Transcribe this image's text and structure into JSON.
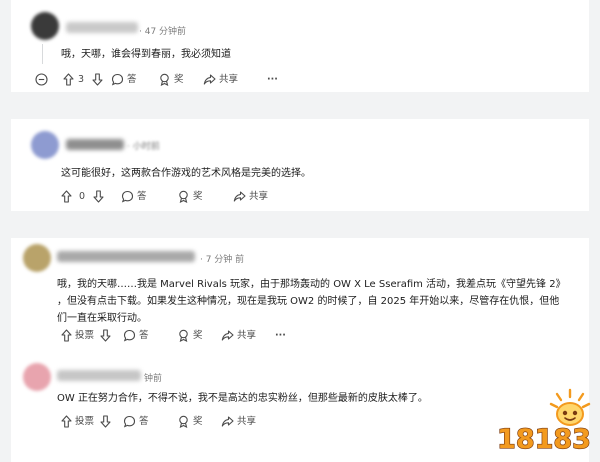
{
  "comments": [
    {
      "meta": "· 47 分钟前",
      "text": [
        "哦，天哪，谁会得到春丽，我必须知道"
      ],
      "votes": "3",
      "reply_label": "答",
      "award_label": "奖",
      "share_label": "共享",
      "more_label": "···"
    },
    {
      "meta": "· 小时前",
      "text": [
        "这可能很好，这两款合作游戏的艺术风格是完美的选择。"
      ],
      "votes": "0",
      "reply_label": "答",
      "award_label": "奖",
      "share_label": "共享",
      "more_label": "···"
    },
    {
      "meta": "· 7 分钟 前",
      "text": [
        "哦，我的天哪……我是 Marvel Rivals 玩家，由于那场轰动的 OW X Le Sserafim 活动，我差点玩《守望先锋 2》",
        "，但没有点击下载。如果发生这种情况，现在是我玩 OW2 的时候了，自 2025 年开始以来，尽管存在仇恨，但他",
        "们一直在采取行动。"
      ],
      "votes_label": "投票",
      "reply_label": "答",
      "award_label": "奖",
      "share_label": "共享",
      "more_label": "···"
    },
    {
      "meta": "钟前",
      "text": [
        "OW 正在努力合作，不得不说，我不是高达的忠实粉丝，但那些最新的皮肤太棒了。"
      ],
      "votes_label": "投票",
      "reply_label": "答",
      "award_label": "奖",
      "share_label": "共享",
      "more_label": "···"
    }
  ],
  "logo_text": "18183",
  "colors": {
    "page_bg": "#f2f3f4",
    "card_bg": "#ffffff",
    "meta": "#7c7c7c",
    "logo_orange": "#f39a1e"
  }
}
